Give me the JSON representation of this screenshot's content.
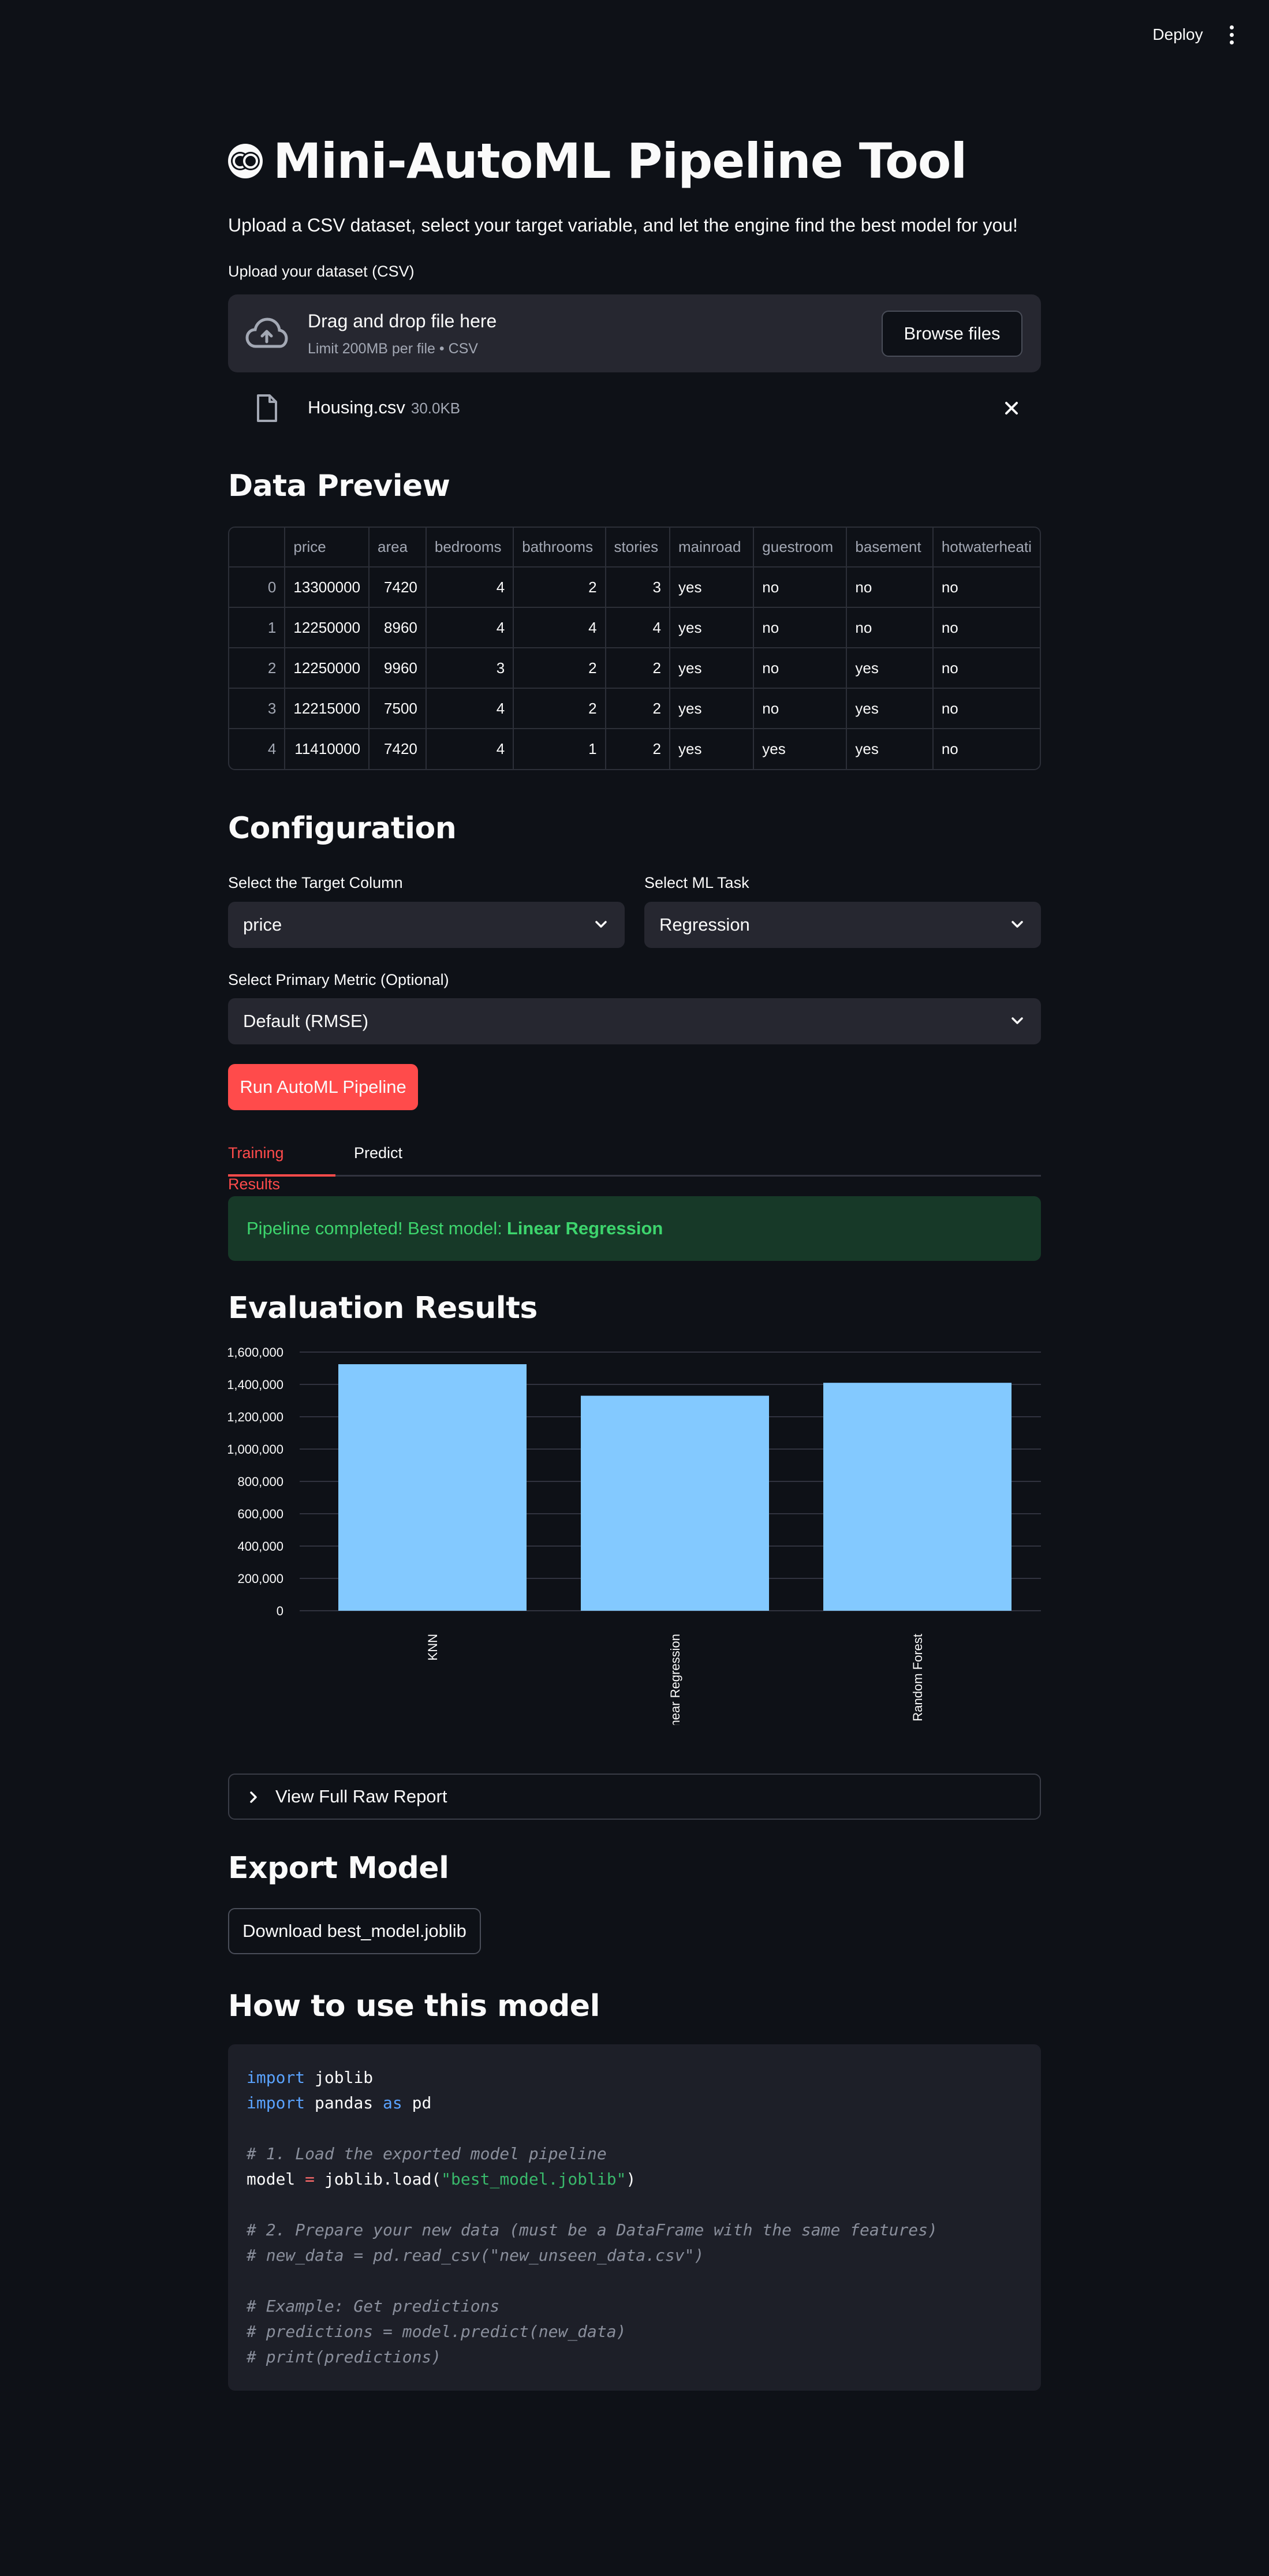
{
  "header": {
    "deploy_label": "Deploy",
    "menu_icon": "kebab-menu-icon"
  },
  "app": {
    "title": "Mini-AutoML Pipeline Tool",
    "title_icon": "owl-emoji-icon",
    "subtitle": "Upload a CSV dataset, select your target variable, and let the engine find the best model for you!"
  },
  "upload": {
    "label": "Upload your dataset (CSV)",
    "dropzone_title": "Drag and drop file here",
    "dropzone_limit": "Limit 200MB per file • CSV",
    "browse_label": "Browse files",
    "file_name": "Housing.csv",
    "file_size": "30.0KB"
  },
  "preview": {
    "heading": "Data Preview",
    "columns": [
      "",
      "price",
      "area",
      "bedrooms",
      "bathrooms",
      "stories",
      "mainroad",
      "guestroom",
      "basement",
      "hotwaterheati"
    ],
    "rows": [
      [
        "0",
        "13300000",
        "7420",
        "4",
        "2",
        "3",
        "yes",
        "no",
        "no",
        "no"
      ],
      [
        "1",
        "12250000",
        "8960",
        "4",
        "4",
        "4",
        "yes",
        "no",
        "no",
        "no"
      ],
      [
        "2",
        "12250000",
        "9960",
        "3",
        "2",
        "2",
        "yes",
        "no",
        "yes",
        "no"
      ],
      [
        "3",
        "12215000",
        "7500",
        "4",
        "2",
        "2",
        "yes",
        "no",
        "yes",
        "no"
      ],
      [
        "4",
        "11410000",
        "7420",
        "4",
        "1",
        "2",
        "yes",
        "yes",
        "yes",
        "no"
      ]
    ]
  },
  "config": {
    "heading": "Configuration",
    "target_label": "Select the Target Column",
    "target_value": "price",
    "task_label": "Select ML Task",
    "task_value": "Regression",
    "metric_label": "Select Primary Metric (Optional)",
    "metric_value": "Default (RMSE)",
    "run_label": "Run AutoML Pipeline"
  },
  "tabs": [
    {
      "label": "Training Results",
      "active": true
    },
    {
      "label": "Predict",
      "active": false
    }
  ],
  "results": {
    "success_prefix": "Pipeline completed! Best model:",
    "best_model": "Linear Regression",
    "eval_heading": "Evaluation Results",
    "expander_label": "View Full Raw Report"
  },
  "chart_data": {
    "type": "bar",
    "categories": [
      "KNN",
      "Linear Regression",
      "Random Forest"
    ],
    "values": [
      1525000,
      1330000,
      1410000
    ],
    "ylim": [
      0,
      1600000
    ],
    "yticks": [
      0,
      200000,
      400000,
      600000,
      800000,
      1000000,
      1200000,
      1400000,
      1600000
    ],
    "ytick_labels": [
      "0",
      "200,000",
      "400,000",
      "600,000",
      "800,000",
      "1,000,000",
      "1,200,000",
      "1,400,000",
      "1,600,000"
    ],
    "bar_color": "#83c9ff",
    "grid": true
  },
  "export": {
    "heading": "Export Model",
    "download_label": "Download best_model.joblib"
  },
  "usage": {
    "heading": "How to use this model",
    "code_lines": [
      "import joblib",
      "import pandas as pd",
      "",
      "# 1. Load the exported model pipeline",
      "model = joblib.load(\"best_model.joblib\")",
      "",
      "# 2. Prepare your new data (must be a DataFrame with the same features)",
      "# new_data = pd.read_csv(\"new_unseen_data.csv\")",
      "",
      "# Example: Get predictions",
      "# predictions = model.predict(new_data)",
      "# print(predictions)"
    ]
  },
  "colors": {
    "background": "#0e1117",
    "widget": "#262730",
    "primary": "#ff4b4b",
    "success_bg": "#173928",
    "success_text": "#3dd56d"
  }
}
